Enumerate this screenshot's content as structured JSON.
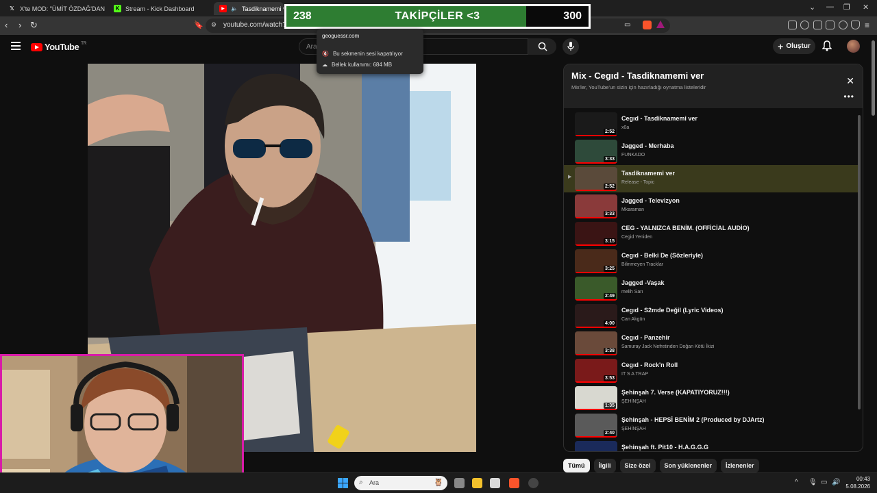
{
  "browser": {
    "tabs": [
      {
        "label": "X'te MOD: \"ÜMİT ÖZDAĞ'DAN YENİ",
        "icon": "x-logo-icon",
        "active": false
      },
      {
        "label": "Stream - Kick Dashboard",
        "icon": "kick-logo-icon",
        "active": false
      },
      {
        "label": "Tasdiknamemi ver - Yo",
        "icon": "youtube-logo-icon",
        "active": true
      }
    ],
    "url": "youtube.com/watch?v=",
    "tooltip": {
      "domain": "geoguessr.com",
      "muted": "Bu sekmenin sesi kapatılıyor",
      "memory": "Bellek kullanımı: 684 MB"
    }
  },
  "overlay": {
    "current": "238",
    "label": "TAKİPÇİLER <3",
    "goal": "300",
    "progress_fraction": 0.793,
    "fill_color": "#2e7d32"
  },
  "youtube": {
    "logo_text": "YouTube",
    "country_code": "TR",
    "search_placeholder": "Ara",
    "create_label": "Oluştur"
  },
  "playlist": {
    "title": "Mix - Cegıd - Tasdiknamemi ver",
    "subtitle": "Mix'ler, YouTube'un sizin için hazırladığı oynatma listeleridir",
    "items": [
      {
        "title": "Cegıd - Tasdiknamemi ver",
        "channel": "x0a",
        "duration": "2:52",
        "thumb_color": "#1a1a1a",
        "active": false
      },
      {
        "title": "Jagged - Merhaba",
        "channel": "FUNKADO",
        "duration": "3:33",
        "thumb_color": "#2e4a3a",
        "active": false
      },
      {
        "title": "Tasdiknamemi ver",
        "channel": "Release - Topic",
        "duration": "2:52",
        "thumb_color": "#5a4a3a",
        "active": true
      },
      {
        "title": "Jagged - Televizyon",
        "channel": "Mkaraman",
        "duration": "3:33",
        "thumb_color": "#8a3a3a",
        "active": false
      },
      {
        "title": "CEG - YALNIZCA BENİM. (OFFİCİAL AUDİO)",
        "channel": "Cegid Yeniden",
        "duration": "3:15",
        "thumb_color": "#3a1414",
        "active": false
      },
      {
        "title": "Cegıd - Belki De (Sözleriyle)",
        "channel": "Bilinmeyen Tracklar",
        "duration": "3:25",
        "thumb_color": "#4a2a1a",
        "active": false
      },
      {
        "title": "Jagged -Vaşak",
        "channel": "melih Sarı",
        "duration": "2:49",
        "thumb_color": "#3a5a2a",
        "active": false
      },
      {
        "title": "Cegıd - S2mde Değil (Lyric Videos)",
        "channel": "Can Akgün",
        "duration": "4:00",
        "thumb_color": "#2a1a1a",
        "active": false
      },
      {
        "title": "Cegıd - Panzehir",
        "channel": "Samuray Jack Nefretinden Doğan Kötü İkizi",
        "duration": "3:38",
        "thumb_color": "#6a4a3a",
        "active": false
      },
      {
        "title": "Cegıd - Rock'n Roll",
        "channel": "IT S A TRAP",
        "duration": "3:53",
        "thumb_color": "#7a1a1a",
        "active": false
      },
      {
        "title": "Şehinşah 7. Verse (KAPATIYORUZ!!!)",
        "channel": "ŞEHİNŞAH",
        "duration": "1:35",
        "thumb_color": "#d8d8d0",
        "active": false
      },
      {
        "title": "Şehinşah - HEPSİ BENİM 2 (Produced by DJArtz)",
        "channel": "ŞEHİNŞAH",
        "duration": "2:40",
        "thumb_color": "#5a5a5a",
        "active": false
      },
      {
        "title": "Şehinşah ft. Pit10 - H.A.G.G.G",
        "channel": "ŞEHİNŞAH",
        "duration": "",
        "thumb_color": "#1a2a5a",
        "active": false
      }
    ]
  },
  "chips": [
    "Tümü",
    "İlgili",
    "Size özel",
    "Son yüklenenler",
    "İzlenenler"
  ],
  "taskbar": {
    "search_placeholder": "Ara",
    "time": "00:43",
    "date": "5.08.2026"
  }
}
